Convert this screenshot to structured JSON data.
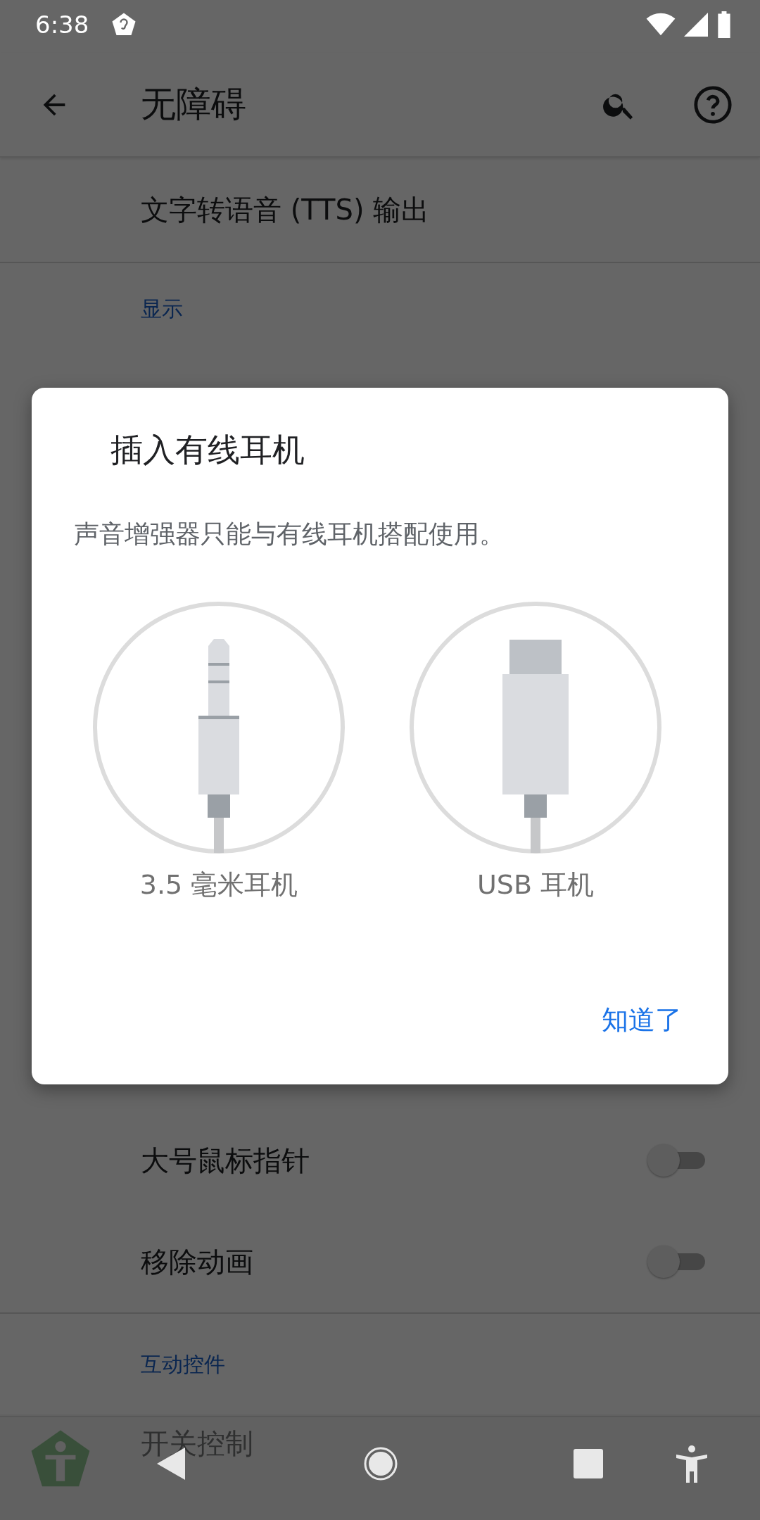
{
  "status_bar": {
    "time": "6:38"
  },
  "app_bar": {
    "title": "无障碍"
  },
  "top_items": [
    {
      "kind": "item",
      "title": "文字转语音 (TTS) 输出"
    },
    {
      "kind": "header",
      "title": "显示"
    }
  ],
  "bottom_items": [
    {
      "kind": "toggle",
      "title": "大号鼠标指针",
      "on": false
    },
    {
      "kind": "toggle",
      "title": "移除动画",
      "on": false
    },
    {
      "kind": "header",
      "title": "互动控件"
    },
    {
      "kind": "item",
      "title": "开关控制"
    }
  ],
  "dialog": {
    "title": "插入有线耳机",
    "message": "声音增强器只能与有线耳机搭配使用。",
    "options": [
      {
        "kind": "jack",
        "label": "3.5 毫米耳机"
      },
      {
        "kind": "usb",
        "label": "USB 耳机"
      }
    ],
    "button": "知道了"
  }
}
